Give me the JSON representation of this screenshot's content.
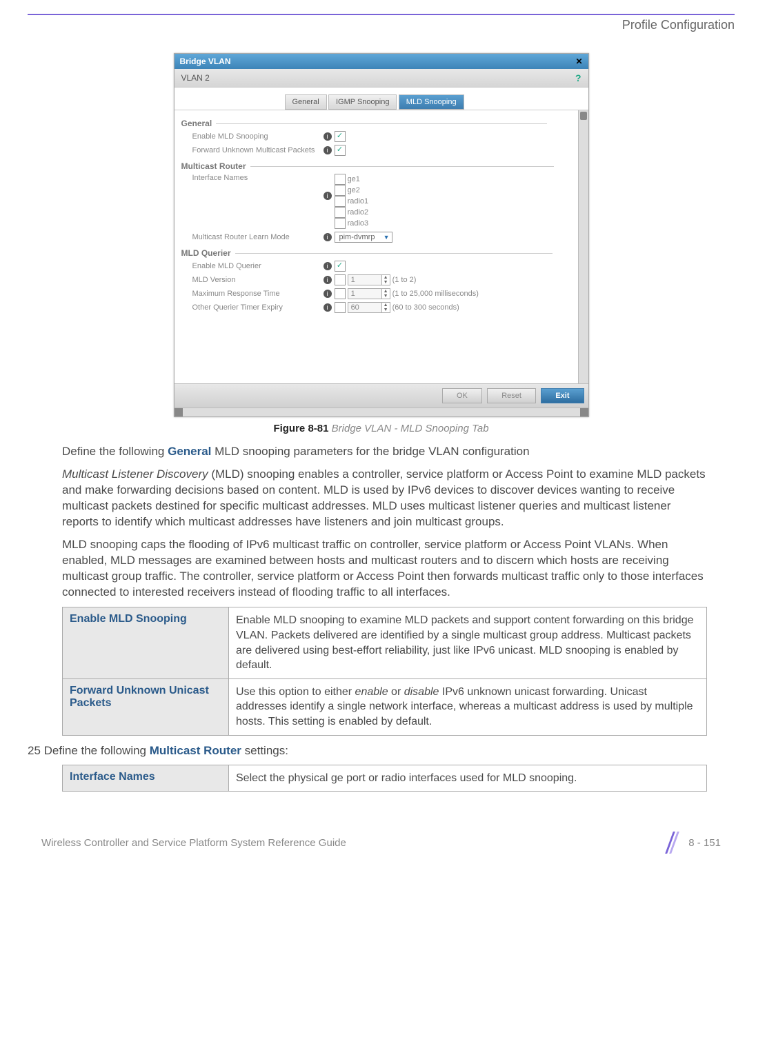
{
  "header": {
    "section": "Profile Configuration"
  },
  "screenshot": {
    "titlebar": "Bridge VLAN",
    "subbar": "VLAN 2",
    "tabs": {
      "general": "General",
      "igmp": "IGMP Snooping",
      "mld": "MLD Snooping"
    },
    "sections": {
      "general": {
        "title": "General",
        "enable_mld": "Enable MLD Snooping",
        "forward_unknown": "Forward Unknown Multicast Packets"
      },
      "multicast_router": {
        "title": "Multicast Router",
        "interface_names": "Interface Names",
        "interfaces": {
          "ge1": "ge1",
          "ge2": "ge2",
          "radio1": "radio1",
          "radio2": "radio2",
          "radio3": "radio3"
        },
        "learn_mode_label": "Multicast Router Learn Mode",
        "learn_mode_value": "pim-dvmrp"
      },
      "mld_querier": {
        "title": "MLD Querier",
        "enable": "Enable MLD Querier",
        "version_label": "MLD Version",
        "version_value": "1",
        "version_range": "(1 to 2)",
        "max_resp_label": "Maximum Response Time",
        "max_resp_value": "1",
        "max_resp_range": "(1 to 25,000 milliseconds)",
        "expiry_label": "Other Querier Timer Expiry",
        "expiry_value": "60",
        "expiry_range": "(60 to 300 seconds)"
      }
    },
    "buttons": {
      "ok": "OK",
      "reset": "Reset",
      "exit": "Exit"
    }
  },
  "figure": {
    "number": "Figure 8-81",
    "caption": "Bridge VLAN - MLD Snooping Tab"
  },
  "paragraphs": {
    "p1a": "Define the following ",
    "p1b": "General",
    "p1c": " MLD snooping parameters for the bridge VLAN configuration",
    "p2a": "Multicast Listener Discovery",
    "p2b": " (MLD) snooping enables a controller, service platform or Access Point to examine MLD packets and make forwarding decisions based on content. MLD is used by IPv6 devices to discover devices wanting to receive multicast packets destined for specific multicast addresses. MLD uses multicast listener queries and multicast listener reports to identify which multicast addresses have listeners and join multicast groups.",
    "p3": "MLD snooping caps the flooding of IPv6 multicast traffic on controller, service platform or Access Point VLANs. When enabled, MLD messages are examined between hosts and multicast routers and to discern which hosts are receiving multicast group traffic. The controller, service platform or Access Point then forwards multicast traffic only to those interfaces connected to interested receivers instead of flooding traffic to all interfaces."
  },
  "table1": {
    "r1k": "Enable MLD Snooping",
    "r1v": "Enable MLD snooping to examine MLD packets and support content forwarding on this bridge VLAN. Packets delivered are identified by a single multicast group address. Multicast packets are delivered using best-effort reliability, just like IPv6 unicast. MLD snooping is enabled by default.",
    "r2k": "Forward Unknown Unicast Packets",
    "r2v_a": "Use this option to either ",
    "r2v_b": "enable",
    "r2v_c": " or ",
    "r2v_d": "disable",
    "r2v_e": " IPv6 unknown unicast forwarding. Unicast addresses identify a single network interface, whereas a multicast address is used by multiple hosts. This setting is enabled by default."
  },
  "step25a": "25 Define the following ",
  "step25b": "Multicast Router",
  "step25c": " settings:",
  "table2": {
    "r1k": "Interface Names",
    "r1v": "Select the physical ge port or radio interfaces used for MLD snooping."
  },
  "footer": {
    "left": "Wireless Controller and Service Platform System Reference Guide",
    "right": "8 - 151"
  }
}
